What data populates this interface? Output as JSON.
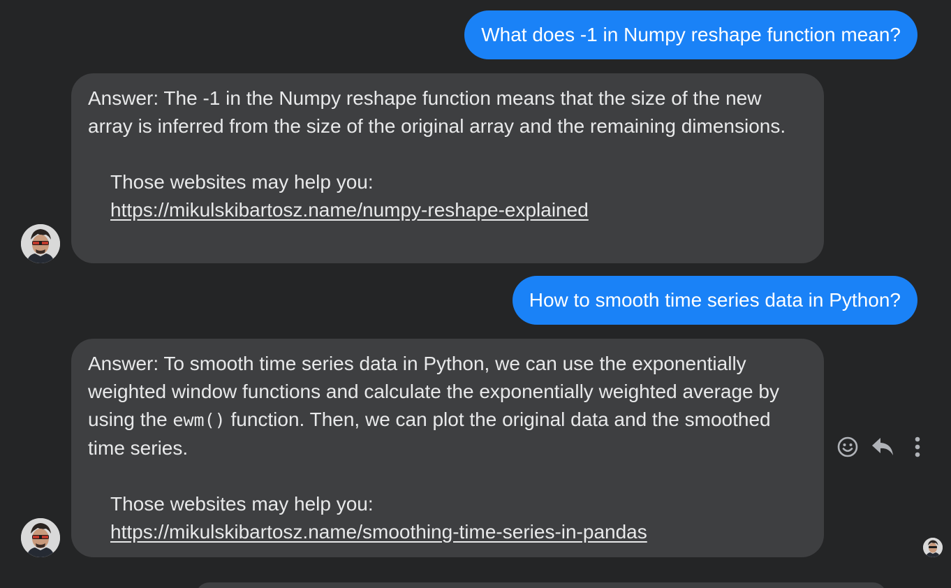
{
  "messages": [
    {
      "sender": "user",
      "text": "What does -1 in Numpy reshape function mean?"
    },
    {
      "sender": "bot",
      "answer": "Answer: The -1 in the Numpy reshape function means that the size of the new array is inferred from the size of the original array and the remaining dimensions.",
      "help_text": "Those websites may help you:",
      "link": "https://mikulskibartosz.name/numpy-reshape-explained"
    },
    {
      "sender": "user",
      "text": "How to smooth time series data in Python?"
    },
    {
      "sender": "bot",
      "answer_before_code": "Answer: To smooth time series data in Python, we can use the exponentially weighted window functions and calculate the exponentially weighted average by using the",
      "code": "ewm()",
      "answer_after_code": "function. Then, we can plot the original data and the smoothed time series.",
      "help_text": "Those websites may help you:",
      "link": "https://mikulskibartosz.name/smoothing-time-series-in-pandas"
    }
  ],
  "actions": {
    "react_icon": "smiley-icon",
    "reply_icon": "reply-icon",
    "more_icon": "more-vertical-icon"
  },
  "colors": {
    "background": "#242526",
    "outgoing_bubble": "#1a82f7",
    "incoming_bubble": "#3e3f41",
    "text": "#e8e9ea",
    "icon": "#b0b3b8"
  }
}
